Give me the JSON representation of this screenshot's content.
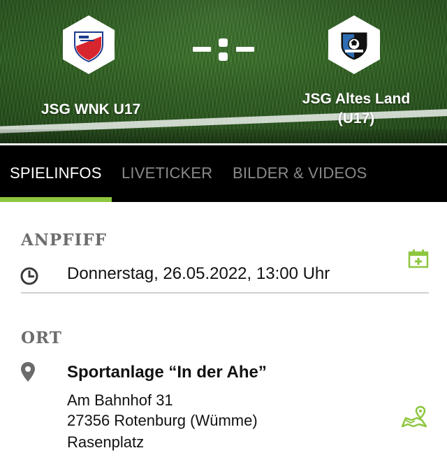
{
  "match": {
    "home_team": "JSG WNK U17",
    "away_team": "JSG Altes Land (U17)",
    "home_logo_icon": "club-crest-red-white",
    "away_logo_icon": "club-crest-blue-black",
    "score_display": "- : -"
  },
  "tabs": [
    {
      "label": "SPIELINFOS",
      "active": true
    },
    {
      "label": "LIVETICKER",
      "active": false
    },
    {
      "label": "BILDER & VIDEOS",
      "active": false
    }
  ],
  "kickoff": {
    "title": "ANPFIFF",
    "datetime": "Donnerstag, 26.05.2022, 13:00 Uhr",
    "icon": "clock-icon",
    "action_icon": "calendar-add-icon"
  },
  "venue": {
    "title": "ORT",
    "name": "Sportanlage “In der Ahe”",
    "address_line1": "Am Bahnhof 31",
    "address_line2": "27356 Rotenburg (Wümme)",
    "surface": "Rasenplatz",
    "icon": "location-pin-icon",
    "action_icon": "map-route-icon"
  },
  "colors": {
    "accent": "#8dc63f",
    "tabbar_bg": "#000000",
    "section_title": "#6d6d6d"
  }
}
